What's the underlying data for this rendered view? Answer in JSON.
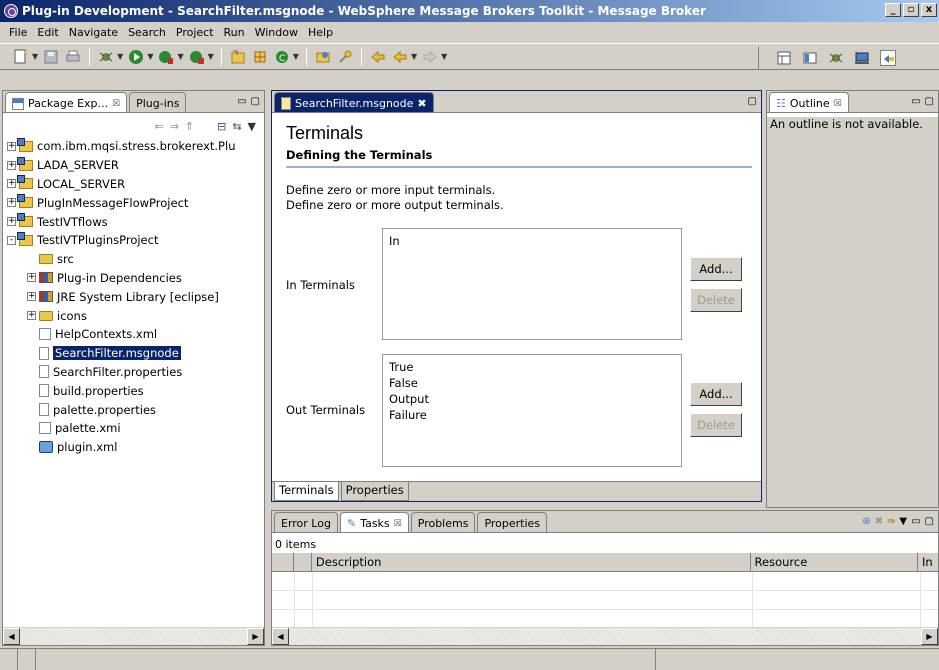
{
  "window": {
    "title": "Plug-in Development - SearchFilter.msgnode - WebSphere Message Brokers Toolkit - Message Broker",
    "controls": [
      "_",
      "▫",
      "x"
    ]
  },
  "menu": [
    "File",
    "Edit",
    "Navigate",
    "Search",
    "Project",
    "Run",
    "Window",
    "Help"
  ],
  "package_explorer": {
    "tabs": [
      {
        "label": "Package Exp...",
        "close": "☒"
      },
      {
        "label": "Plug-ins"
      }
    ],
    "tree": [
      {
        "label": "com.ibm.mqsi.stress.brokerext.Plu",
        "indent": 0,
        "expander": "+",
        "icon": "project"
      },
      {
        "label": "LADA_SERVER",
        "indent": 0,
        "expander": "+",
        "icon": "project"
      },
      {
        "label": "LOCAL_SERVER",
        "indent": 0,
        "expander": "+",
        "icon": "project"
      },
      {
        "label": "PlugInMessageFlowProject",
        "indent": 0,
        "expander": "+",
        "icon": "project"
      },
      {
        "label": "TestIVTflows",
        "indent": 0,
        "expander": "+",
        "icon": "project"
      },
      {
        "label": "TestIVTPluginsProject",
        "indent": 0,
        "expander": "-",
        "icon": "project"
      },
      {
        "label": "src",
        "indent": 1,
        "expander": "",
        "icon": "folder"
      },
      {
        "label": "Plug-in Dependencies",
        "indent": 1,
        "expander": "+",
        "icon": "library"
      },
      {
        "label": "JRE System Library [eclipse]",
        "indent": 1,
        "expander": "+",
        "icon": "library"
      },
      {
        "label": "icons",
        "indent": 1,
        "expander": "+",
        "icon": "folder"
      },
      {
        "label": "HelpContexts.xml",
        "indent": 1,
        "expander": "",
        "icon": "xml"
      },
      {
        "label": "SearchFilter.msgnode",
        "indent": 1,
        "expander": "",
        "icon": "file",
        "selected": true
      },
      {
        "label": "SearchFilter.properties",
        "indent": 1,
        "expander": "",
        "icon": "file"
      },
      {
        "label": "build.properties",
        "indent": 1,
        "expander": "",
        "icon": "file"
      },
      {
        "label": "palette.properties",
        "indent": 1,
        "expander": "",
        "icon": "file"
      },
      {
        "label": "palette.xmi",
        "indent": 1,
        "expander": "",
        "icon": "xml"
      },
      {
        "label": "plugin.xml",
        "indent": 1,
        "expander": "",
        "icon": "plugin"
      }
    ]
  },
  "editor": {
    "tab_label": "SearchFilter.msgnode",
    "tab_close": "✖",
    "heading": "Terminals",
    "subheading": "Defining the Terminals",
    "desc1": "Define zero or more input terminals.",
    "desc2": "Define zero or more output terminals.",
    "in_label": "In Terminals",
    "in_items": [
      "In"
    ],
    "out_label": "Out Terminals",
    "out_items": [
      "True",
      "False",
      "Output",
      "Failure"
    ],
    "add_label": "Add...",
    "delete_label": "Delete",
    "bottom_tabs": [
      "Terminals",
      "Properties"
    ]
  },
  "outline": {
    "tab_label": "Outline",
    "tab_close": "☒",
    "message": "An outline is not available."
  },
  "tasks": {
    "tabs": [
      "Error Log",
      "Tasks",
      "Problems",
      "Properties"
    ],
    "tasks_close": "☒",
    "count": "0 items",
    "columns": [
      "",
      "",
      "Description",
      "Resource",
      "In"
    ]
  },
  "colors": {
    "selection": "#0a246a",
    "chrome": "#d4d0c8"
  }
}
